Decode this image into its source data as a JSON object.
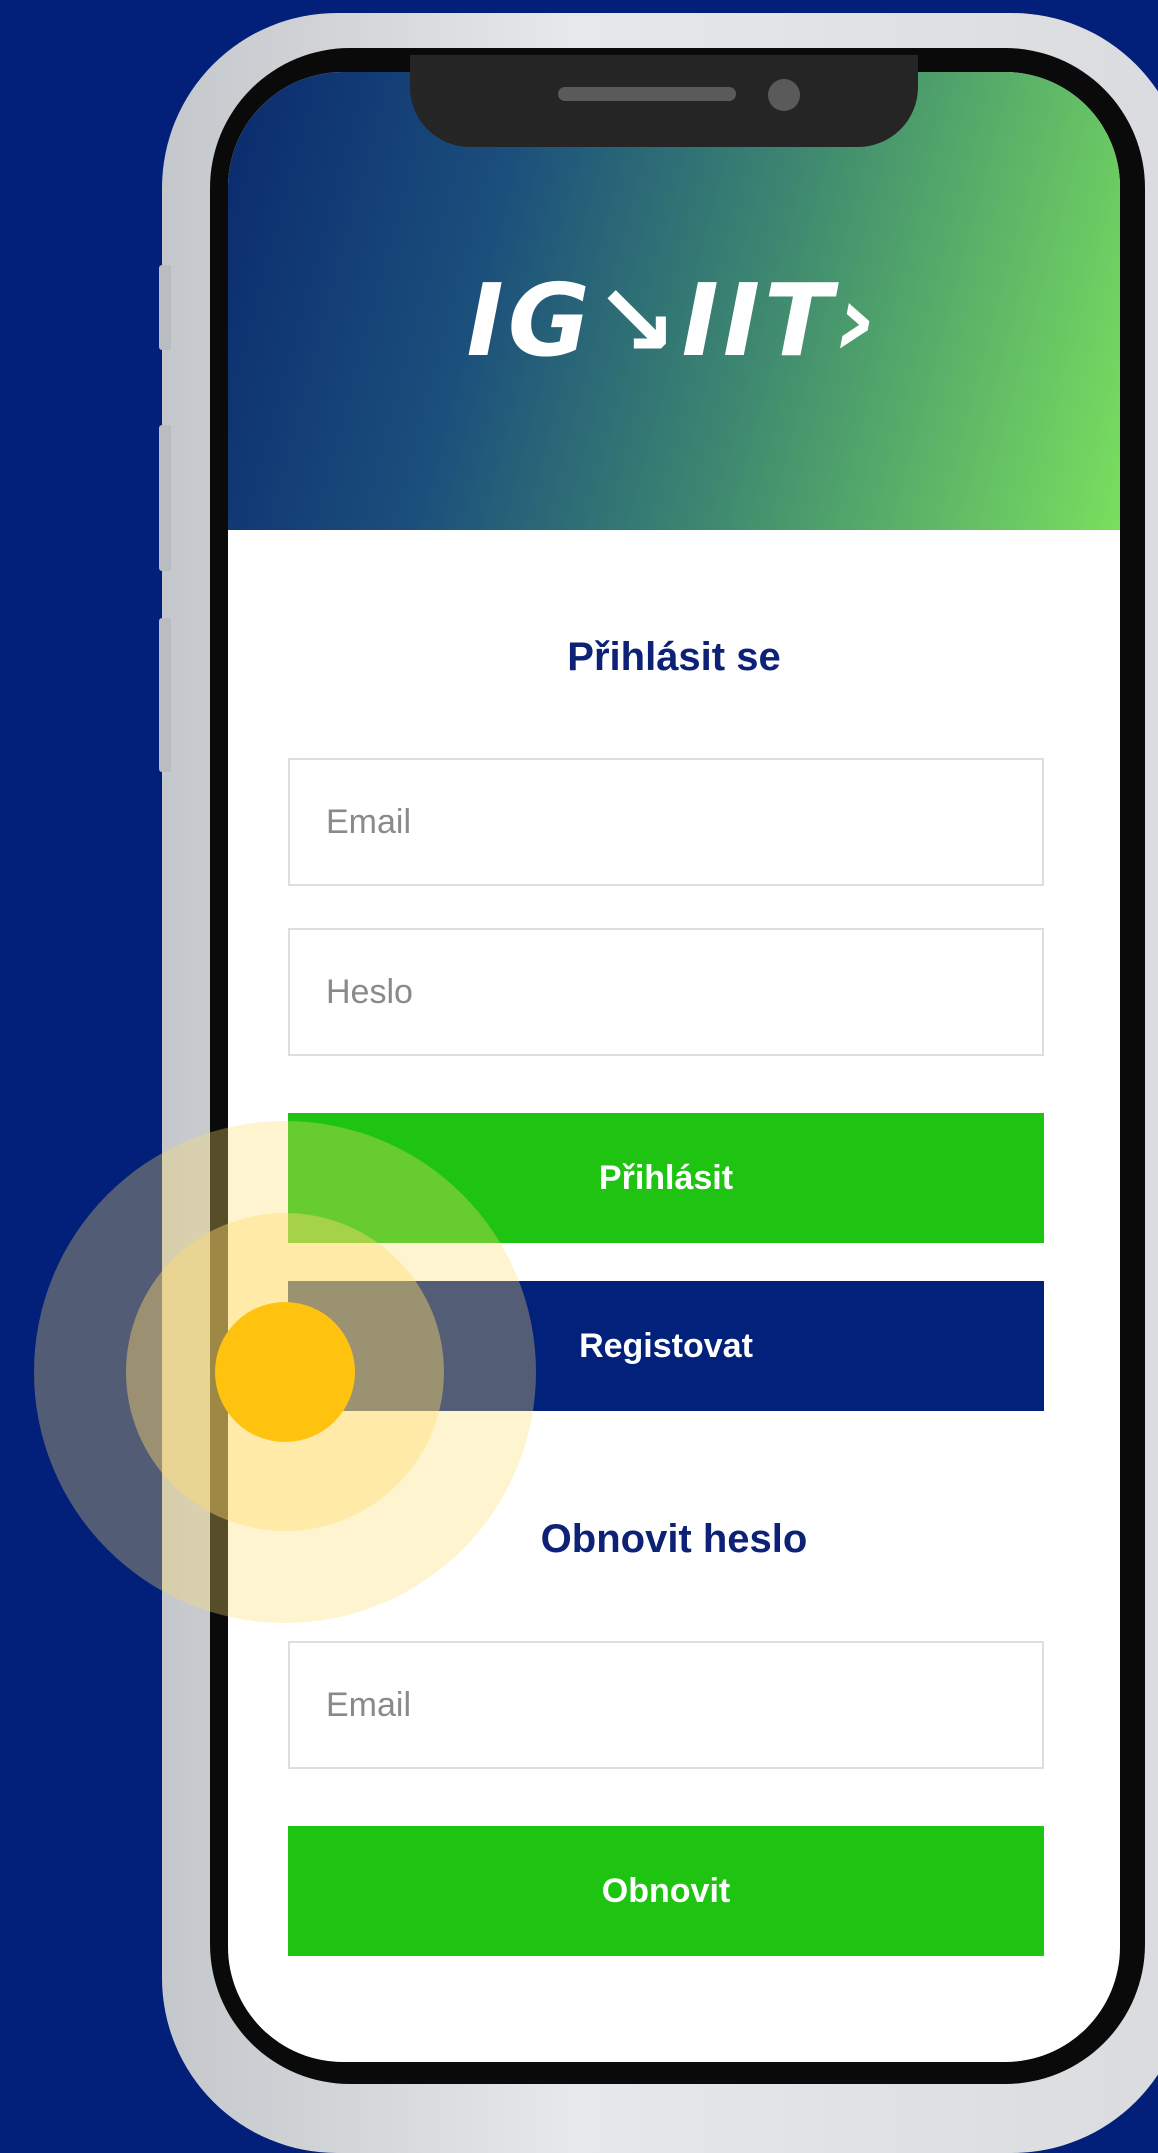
{
  "app": {
    "logo_text": "IG↘IIT›"
  },
  "login": {
    "title": "Přihlásit se",
    "email_placeholder": "Email",
    "password_placeholder": "Heslo",
    "login_button": "Přihlásit",
    "register_button": "Registovat"
  },
  "reset": {
    "title": "Obnovit heslo",
    "email_placeholder": "Email",
    "reset_button": "Obnovit"
  },
  "colors": {
    "background": "#021f7a",
    "primary_green": "#1fc412",
    "primary_blue": "#02217a",
    "title_blue": "#0d2277",
    "tap_indicator": "#ffc30f"
  },
  "icons": [
    "notch-speaker-icon",
    "camera-icon",
    "tap-indicator-icon"
  ]
}
